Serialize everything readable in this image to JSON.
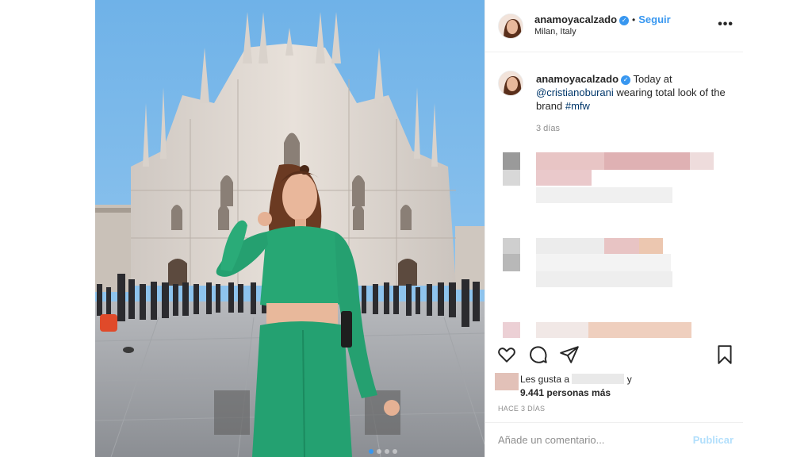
{
  "post": {
    "username": "anamoyacalzado",
    "verified": true,
    "separator": "•",
    "follow_label": "Seguir",
    "location": "Milan, Italy",
    "more_icon": "more-horizontal-icon"
  },
  "caption": {
    "username": "anamoyacalzado",
    "text_before": "Today at",
    "mention": "@cristianoburani",
    "text_middle": "wearing total look of the brand",
    "hashtag": "#mfw",
    "time": "3 días"
  },
  "actions": {
    "like_icon": "heart-icon",
    "comment_icon": "comment-icon",
    "share_icon": "paper-plane-icon",
    "save_icon": "bookmark-icon"
  },
  "likes": {
    "prefix": "Les gusta a",
    "suffix": "y",
    "count_text": "9.441 personas más"
  },
  "posted_ago": "HACE 3 DÍAS",
  "comment": {
    "placeholder": "Añade un comentario...",
    "publish_label": "Publicar"
  },
  "carousel": {
    "slides": 4,
    "active_slide": 1
  },
  "colors": {
    "accent": "#3897f0",
    "text": "#262626",
    "muted": "#8e8e8e",
    "outfit": "#1f9e6a"
  }
}
